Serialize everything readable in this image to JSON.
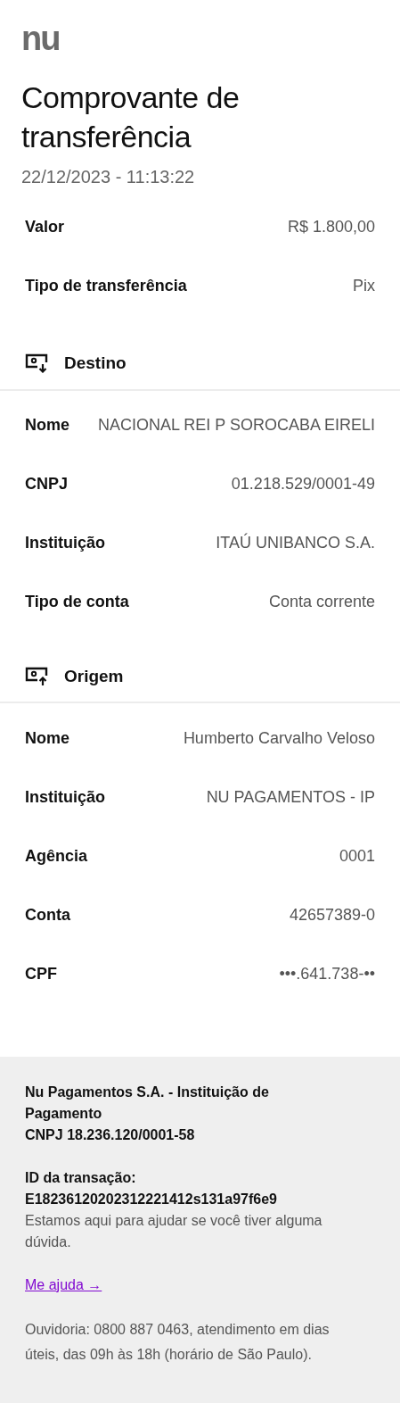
{
  "logo": "nu",
  "title": "Comprovante de transferência",
  "datetime": "22/12/2023 - 11:13:22",
  "summary": [
    {
      "label": "Valor",
      "value": "R$ 1.800,00"
    },
    {
      "label": "Tipo de transferência",
      "value": "Pix"
    }
  ],
  "sections": [
    {
      "kind": "destination",
      "heading": "Destino",
      "rows": [
        {
          "label": "Nome",
          "value": "NACIONAL REI P SOROCABA EIRELI"
        },
        {
          "label": "CNPJ",
          "value": "01.218.529/0001-49"
        },
        {
          "label": "Instituição",
          "value": "ITAÚ UNIBANCO S.A."
        },
        {
          "label": "Tipo de conta",
          "value": "Conta corrente"
        }
      ]
    },
    {
      "kind": "origin",
      "heading": "Origem",
      "rows": [
        {
          "label": "Nome",
          "value": "Humberto Carvalho Veloso"
        },
        {
          "label": "Instituição",
          "value": "NU PAGAMENTOS - IP"
        },
        {
          "label": "Agência",
          "value": "0001"
        },
        {
          "label": "Conta",
          "value": "42657389-0"
        },
        {
          "label": "CPF",
          "value": "•••.641.738-••"
        }
      ]
    }
  ],
  "footer": {
    "company": "Nu Pagamentos S.A. - Instituição de Pagamento",
    "cnpj": "CNPJ 18.236.120/0001-58",
    "transaction_label": "ID da transação:",
    "transaction_id": "E18236120202312221412s131a97f6e9",
    "help_text": "Estamos aqui para ajudar se você tiver alguma dúvida.",
    "help_link": "Me ajuda →",
    "ombudsman": "Ouvidoria: 0800 887 0463, atendimento em dias úteis, das 09h às 18h (horário de São Paulo)."
  }
}
